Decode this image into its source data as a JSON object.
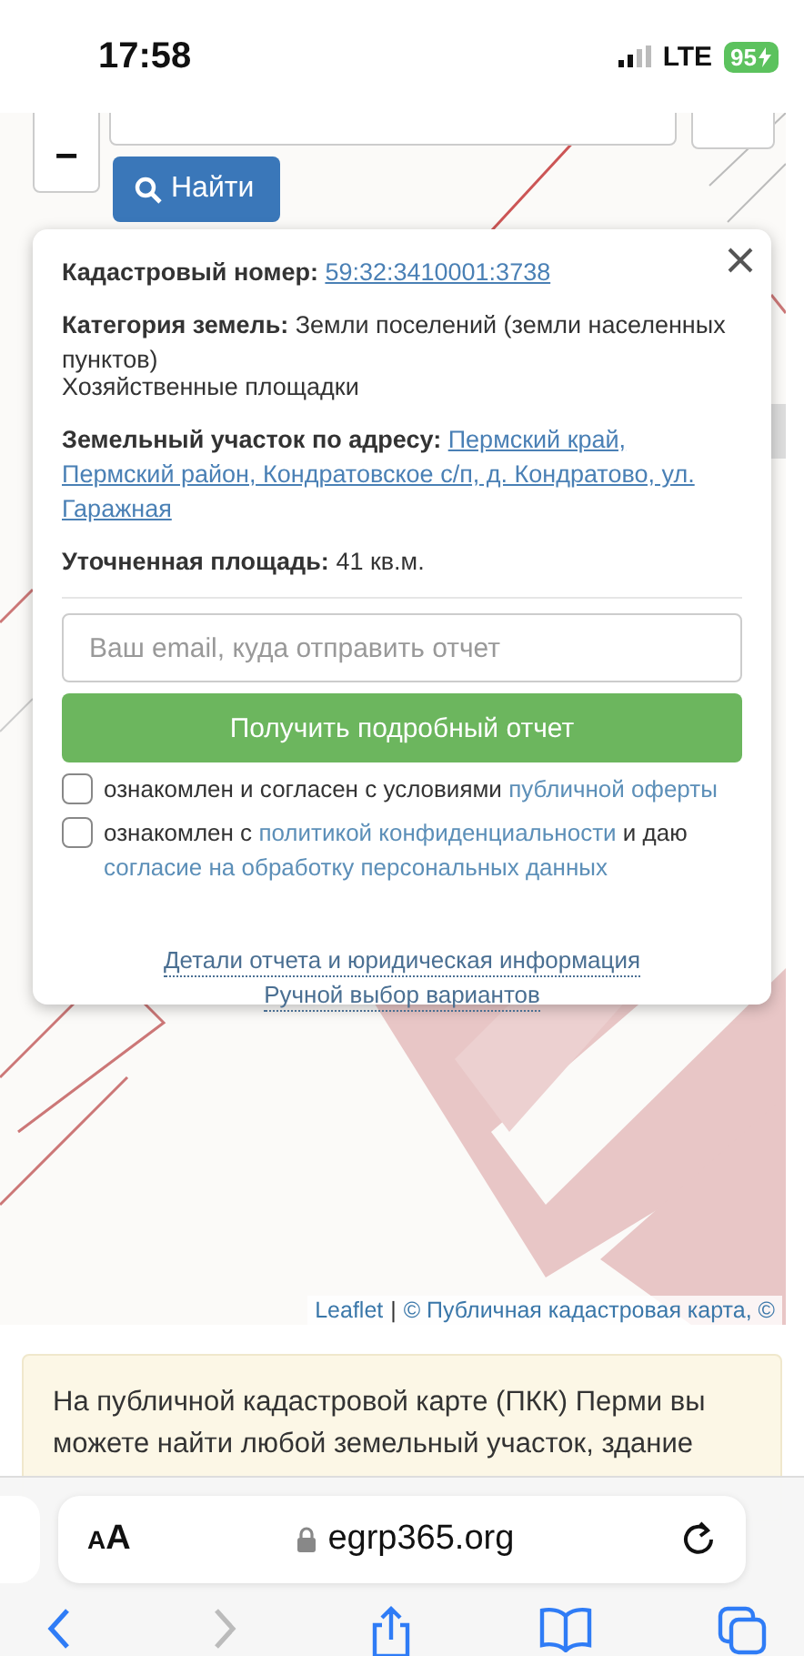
{
  "status_bar": {
    "time": "17:58",
    "network": "LTE",
    "battery": "95"
  },
  "map": {
    "zoom_out": "−",
    "search_button": "Найти",
    "popup": {
      "rows": [
        {
          "kind": "field",
          "label": "Кадастровый номер:",
          "parts": [
            {
              "text": "59:32:3410001:3738",
              "kind": "link"
            }
          ]
        },
        {
          "kind": "field",
          "label": "Категория земель:",
          "parts": [
            {
              "text": "Земли поселений (земли населенных пунктов)",
              "kind": "text"
            }
          ]
        },
        {
          "kind": "plain",
          "parts": [
            {
              "text": "Хозяйственные площадки",
              "kind": "text"
            }
          ]
        },
        {
          "kind": "field",
          "label": "Земельный участок по адресу:",
          "parts": [
            {
              "text": "Пермский край,",
              "kind": "link"
            },
            {
              "text": "Пермский район, Кондратовское с/п, д. Кондратово, ул. Гаражная",
              "kind": "link_block"
            }
          ]
        },
        {
          "kind": "field",
          "label": "Уточненная площадь:",
          "parts": [
            {
              "text": "41 кв.м.",
              "kind": "text"
            }
          ]
        }
      ],
      "email_placeholder": "Ваш email, куда отправить отчет",
      "submit": "Получить подробный отчет",
      "agreements": [
        {
          "checked": false,
          "parts": [
            {
              "text": "ознакомлен и согласен с условиями",
              "kind": "text"
            },
            {
              "text": "публичной оферты",
              "kind": "link"
            }
          ]
        },
        {
          "checked": false,
          "parts": [
            {
              "text": "ознакомлен с",
              "kind": "text"
            },
            {
              "text": "политикой конфиденциальности",
              "kind": "link"
            },
            {
              "text": "и даю",
              "kind": "text"
            },
            {
              "text": "согласие на обработку персональных данных",
              "kind": "link"
            }
          ]
        }
      ],
      "footer_links": [
        "Детали отчета и юридическая информация",
        "Ручной выбор вариантов"
      ]
    },
    "attribution": [
      {
        "text": "Leaflet",
        "kind": "link"
      },
      {
        "text": "|",
        "kind": "text"
      },
      {
        "text": "© Публичная кадастровая карта, ©",
        "kind": "link"
      }
    ]
  },
  "info_text": "На публичной кадастровой карте (ПКК) Перми вы можете найти любой земельный участок, здание",
  "browser": {
    "text_size_small": "A",
    "text_size_large": "A",
    "url": "egrp365.org"
  }
}
